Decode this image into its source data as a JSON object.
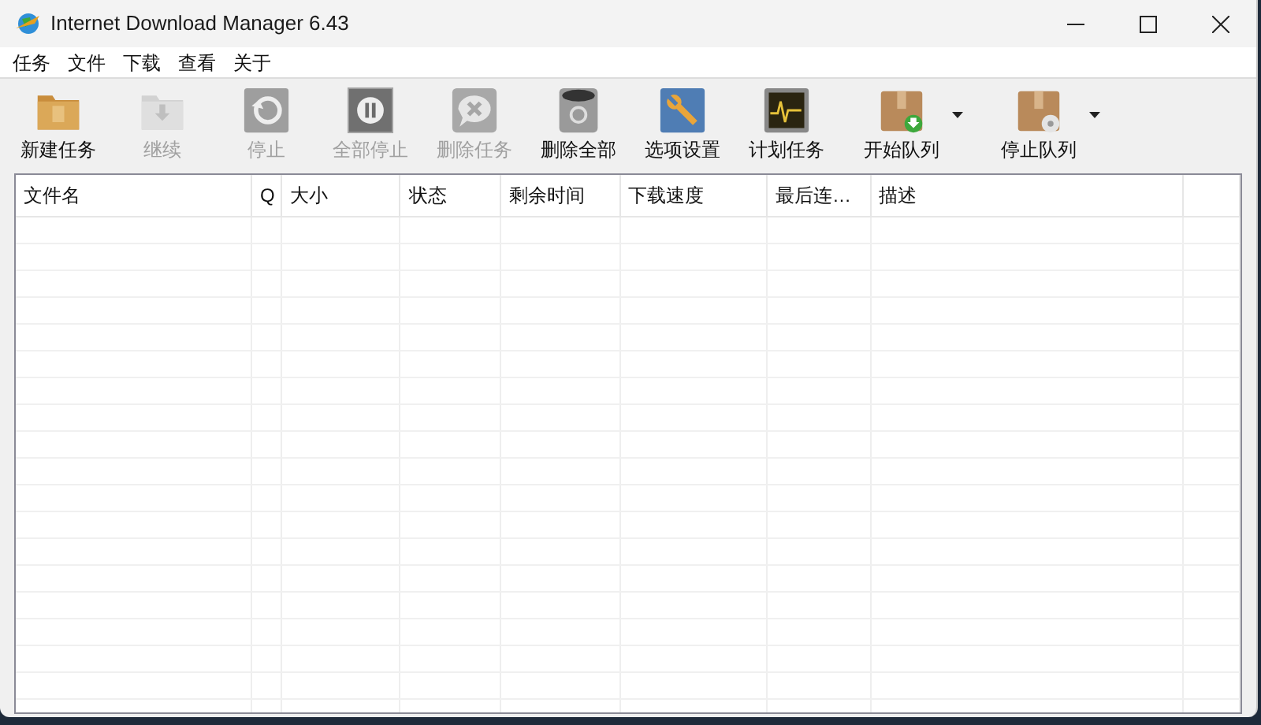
{
  "window": {
    "title": "Internet Download Manager 6.43"
  },
  "menu": [
    "任务",
    "文件",
    "下载",
    "查看",
    "关于"
  ],
  "toolbar": [
    {
      "label": "新建任务",
      "kind": "folder",
      "disabled": false,
      "has_menu": false
    },
    {
      "label": "继续",
      "kind": "folder-down",
      "disabled": true,
      "has_menu": false
    },
    {
      "label": "停止",
      "kind": "restart",
      "disabled": true,
      "has_menu": false
    },
    {
      "label": "全部停止",
      "kind": "pause",
      "disabled": true,
      "has_menu": false
    },
    {
      "label": "删除任务",
      "kind": "bubble-x",
      "disabled": true,
      "has_menu": false
    },
    {
      "label": "删除全部",
      "kind": "trash",
      "disabled": false,
      "has_menu": false
    },
    {
      "label": "选项设置",
      "kind": "wrench",
      "disabled": false,
      "has_menu": false
    },
    {
      "label": "计划任务",
      "kind": "monitor",
      "disabled": false,
      "has_menu": false
    },
    {
      "label": "开始队列",
      "kind": "box-start",
      "disabled": false,
      "has_menu": true
    },
    {
      "label": "停止队列",
      "kind": "box-stop",
      "disabled": false,
      "has_menu": true
    }
  ],
  "table": {
    "columns": [
      "文件名",
      "Q",
      "大小",
      "状态",
      "剩余时间",
      "下载速度",
      "最后连…",
      "描述"
    ]
  }
}
